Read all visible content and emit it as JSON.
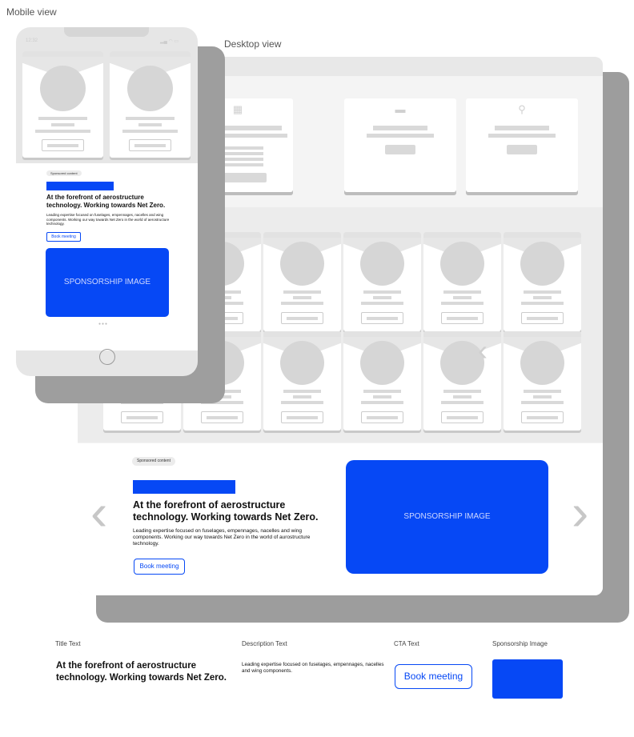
{
  "labels": {
    "mobile": "Mobile view",
    "desktop": "Desktop view"
  },
  "mobile": {
    "time": "12:32",
    "sponsored": "Sponsored content",
    "title": "At the forefront of aerostructure technology. Working towards Net Zero.",
    "description": "Leading expertise focused on fuselages, empennages, nacelles and wing components. Working our way towards Net Zero in the world of aerostructure technology.",
    "cta": "Book meeting",
    "image_text": "SPONSORSHIP IMAGE",
    "pagination": "●●●"
  },
  "desktop": {
    "tiles": [
      {
        "icon": "building-icon",
        "button": "Explore sponsorship profile"
      },
      {
        "icon": "sms-icon",
        "button": "Call number"
      },
      {
        "icon": "search-icon",
        "button": "Start Networking"
      }
    ],
    "sponsored": "Sponsored content",
    "title": "At the forefront of aerostructure technology. Working towards Net Zero.",
    "description": "Leading expertise focused on fuselages, empennages, nacelles and wing components. Working our way towards Net Zero in the world of aurostructure technology.",
    "cta": "Book meeting",
    "image_text": "SPONSORSHIP IMAGE",
    "prev": "‹",
    "next": "›"
  },
  "legend": {
    "title_label": "Title Text",
    "description_label": "Description Text",
    "cta_label": "CTA Text",
    "image_label": "Sponsorship Image",
    "title": "At the forefront of aerostructure technology. Working towards Net Zero.",
    "description": "Leading expertise focused on fuselages, empennages, nacelles and wing components.",
    "cta": "Book meeting"
  },
  "colors": {
    "accent": "#0648f5",
    "placeholder": "#d9d9d9"
  }
}
